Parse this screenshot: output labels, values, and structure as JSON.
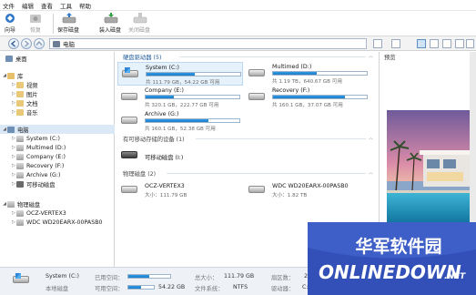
{
  "menu": [
    "文件",
    "编辑",
    "查看",
    "工具",
    "帮助"
  ],
  "toolbar": {
    "wizard": "向导",
    "restore": "恢复",
    "save_disk": "保存磁盘",
    "load_disk": "装入磁盘",
    "close_disk": "关闭磁盘"
  },
  "address": {
    "path": "电脑"
  },
  "tree": {
    "library": "库",
    "videos": "视频",
    "pictures": "图片",
    "documents": "文档",
    "music": "音乐",
    "computer": "电脑",
    "system_c": "System (C:)",
    "multimed_d": "Multimed (D:)",
    "company_e": "Company (E:)",
    "recovery_f": "Recovery (F:)",
    "archive_g": "Archive (G:)",
    "removable": "可移动磁盘",
    "physical": "物理磁盘",
    "ocz": "OCZ-VERTEX3",
    "wdc": "WDC WD20EARX-00PASB0"
  },
  "groups": {
    "hdd": "硬盘驱动器 (5)",
    "removable": "有可移动存储的设备 (1)",
    "physical": "物理磁盘 (2)"
  },
  "drives": [
    {
      "name": "System (C:)",
      "info": "共 111.79 GB，54.22 GB 可用",
      "used": 0.51
    },
    {
      "name": "Multimed (D:)",
      "info": "共 1.19 TB，640.67 GB 可用",
      "used": 0.47
    },
    {
      "name": "Company (E:)",
      "info": "共 320.1 GB，222.77 GB 可用",
      "used": 0.3
    },
    {
      "name": "Recovery (F:)",
      "info": "共 160.1 GB，37.07 GB 可用",
      "used": 0.77
    },
    {
      "name": "Archive (G:)",
      "info": "共 160.1 GB，52.38 GB 可用",
      "used": 0.67
    }
  ],
  "removable_items": [
    {
      "name": "可移动磁盘 (I:)"
    }
  ],
  "physical_items": [
    {
      "name": "OCZ-VERTEX3",
      "info": "大小：111.79 GB"
    },
    {
      "name": "WDC WD20EARX-00PASB0",
      "info": "大小：1.82 TB"
    }
  ],
  "preview": {
    "title": "预览"
  },
  "status": {
    "drive_name": "System (C:)",
    "drive_type": "本地磁盘",
    "used_label": "已用空间：",
    "free_label": "可用空间：",
    "free_value": "54.22 GB",
    "total_label": "总大小：",
    "total_value": "111.79 GB",
    "fs_label": "文件系统：",
    "fs_value": "NTFS",
    "sector_label": "扇区数：",
    "sector_value": "2.0",
    "letter_label": "驱动器：",
    "letter_value": "C:",
    "used_fraction": 0.51,
    "free_fraction": 0.49
  },
  "watermark": {
    "top": "华军软件园",
    "bottom": "ONLINEDOWN",
    "suffix": ".NET"
  }
}
